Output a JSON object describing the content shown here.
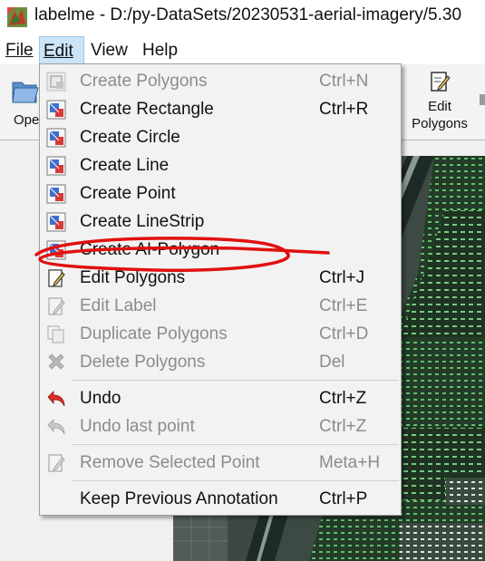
{
  "window": {
    "title": "labelme - D:/py-DataSets/20230531-aerial-imagery/5.30",
    "app_icon": "labelme-app-icon"
  },
  "menubar": {
    "file": "File",
    "edit": "Edit",
    "view": "View",
    "help": "Help"
  },
  "toolbar": {
    "open_label": "Open",
    "open_visible": "Ope",
    "edit_polygons_line1": "Edit",
    "edit_polygons_line2": "Polygons"
  },
  "edit_menu": {
    "items": [
      {
        "label": "Create Polygons",
        "shortcut": "Ctrl+N",
        "enabled": false,
        "icon": "create-polygon-icon"
      },
      {
        "label": "Create Rectangle",
        "shortcut": "Ctrl+R",
        "enabled": true,
        "icon": "create-rectangle-icon"
      },
      {
        "label": "Create Circle",
        "shortcut": "",
        "enabled": true,
        "icon": "create-circle-icon"
      },
      {
        "label": "Create Line",
        "shortcut": "",
        "enabled": true,
        "icon": "create-line-icon"
      },
      {
        "label": "Create Point",
        "shortcut": "",
        "enabled": true,
        "icon": "create-point-icon"
      },
      {
        "label": "Create LineStrip",
        "shortcut": "",
        "enabled": true,
        "icon": "create-linestrip-icon"
      },
      {
        "label": "Create AI-Polygon",
        "shortcut": "",
        "enabled": true,
        "icon": "create-ai-polygon-icon"
      },
      {
        "label": "Edit Polygons",
        "shortcut": "Ctrl+J",
        "enabled": true,
        "icon": "edit-polygons-icon"
      },
      {
        "label": "Edit Label",
        "shortcut": "Ctrl+E",
        "enabled": false,
        "icon": "edit-label-icon"
      },
      {
        "label": "Duplicate Polygons",
        "shortcut": "Ctrl+D",
        "enabled": false,
        "icon": "duplicate-icon"
      },
      {
        "label": "Delete Polygons",
        "shortcut": "Del",
        "enabled": false,
        "icon": "delete-icon"
      },
      {
        "label": "Undo",
        "shortcut": "Ctrl+Z",
        "enabled": true,
        "icon": "undo-icon"
      },
      {
        "label": "Undo last point",
        "shortcut": "Ctrl+Z",
        "enabled": false,
        "icon": "undo-last-point-icon"
      },
      {
        "label": "Remove Selected Point",
        "shortcut": "Meta+H",
        "enabled": false,
        "icon": "remove-point-icon"
      },
      {
        "label": "Keep Previous Annotation",
        "shortcut": "Ctrl+P",
        "enabled": true,
        "icon": ""
      }
    ]
  },
  "colors": {
    "menu_bg": "#f2f2f2",
    "disabled_text": "#8c8c8c",
    "active_menu": "#cce4f7",
    "annotation_red": "#e01010",
    "undo_red": "#d9302a"
  }
}
